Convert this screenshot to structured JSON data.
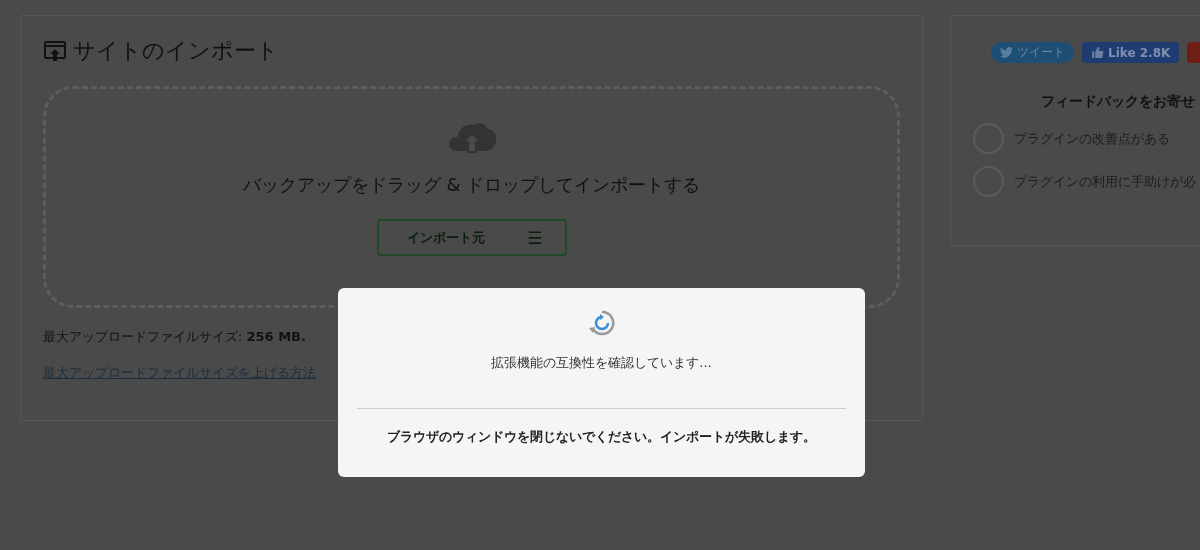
{
  "import_panel": {
    "title": "サイトのインポート",
    "drop_text": "バックアップをドラッグ & ドロップしてインポートする",
    "import_button": "インポート元",
    "menu_glyph": "☰",
    "max_size": "最大アップロードファイルサイズ: **256 MB.**",
    "help_link": "最大アップロードファイルサイズを上げる方法"
  },
  "side_panel": {
    "tweet": "ツイート",
    "like": "Like 2.8K",
    "feedback_title": "フィードバックをお寄せ",
    "options": [
      {
        "label": "プラグインの改善点がある",
        "selected": false
      },
      {
        "label": "プラグインの利用に手助けが必",
        "selected": false
      }
    ]
  },
  "dialog": {
    "message": "拡張機能の互換性を確認しています...",
    "warning": "ブラウザのウィンドウを閉じないでください。インポートが失敗します。"
  }
}
